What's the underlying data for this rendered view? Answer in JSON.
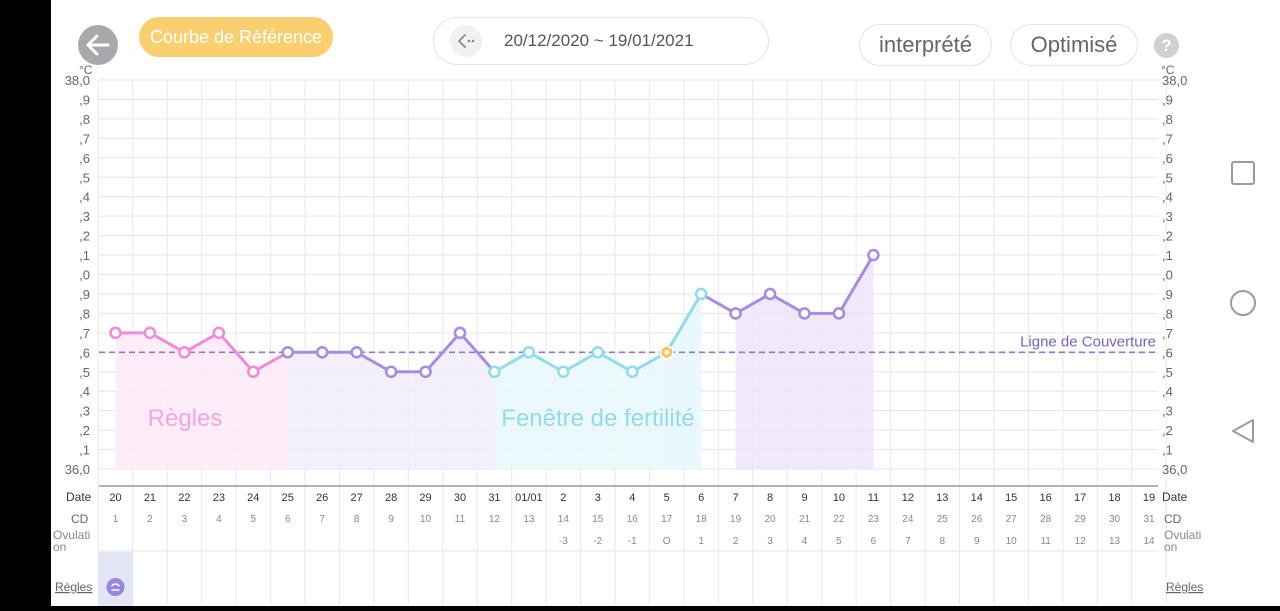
{
  "header": {
    "reference_curve_label": "Courbe de Référence",
    "date_range": "20/12/2020 ~ 19/01/2021",
    "interpret_label": "interprété",
    "optimize_label": "Optimisé",
    "help_label": "?"
  },
  "chart_data": {
    "type": "line",
    "unit": "°C",
    "ylim": [
      36.0,
      38.0
    ],
    "ytick_labels": [
      "38,0",
      ",9",
      ",8",
      ",7",
      ",6",
      ",5",
      ",4",
      ",3",
      ",2",
      ",1",
      ",0",
      ",9",
      ",8",
      ",7",
      ",6",
      ",5",
      ",4",
      ",3",
      ",2",
      ",1",
      "36,0"
    ],
    "row_labels": {
      "date": "Date",
      "cd": "CD",
      "ovulation": [
        "Ovulati",
        "on"
      ],
      "regles": "Règles"
    },
    "dates": [
      "20",
      "21",
      "22",
      "23",
      "24",
      "25",
      "26",
      "27",
      "28",
      "29",
      "30",
      "31",
      "01/01",
      "2",
      "3",
      "4",
      "5",
      "6",
      "7",
      "8",
      "9",
      "10",
      "11",
      "12",
      "13",
      "14",
      "15",
      "16",
      "17",
      "18",
      "19"
    ],
    "cd": [
      "1",
      "2",
      "3",
      "4",
      "5",
      "6",
      "7",
      "8",
      "9",
      "10",
      "11",
      "12",
      "13",
      "14",
      "15",
      "16",
      "17",
      "18",
      "19",
      "20",
      "21",
      "22",
      "23",
      "24",
      "25",
      "26",
      "27",
      "28",
      "29",
      "30",
      "31"
    ],
    "ovulation": [
      "",
      "",
      "",
      "",
      "",
      "",
      "",
      "",
      "",
      "",
      "",
      "",
      "",
      "-3",
      "-2",
      "-1",
      "O",
      "1",
      "2",
      "3",
      "4",
      "5",
      "6",
      "7",
      "8",
      "9",
      "10",
      "11",
      "12",
      "13",
      "14"
    ],
    "temperatures": [
      36.7,
      36.7,
      36.6,
      36.7,
      36.5,
      36.6,
      36.6,
      36.6,
      36.5,
      36.5,
      36.7,
      36.5,
      36.6,
      36.5,
      36.6,
      36.5,
      36.6,
      36.9,
      36.8,
      36.9,
      36.8,
      36.8,
      37.1
    ],
    "coverline": {
      "value": 36.6,
      "label": "Ligne de Couverture"
    },
    "phases": [
      {
        "name": "Règles",
        "start": 0,
        "end": 5,
        "color": "#f28ad8",
        "fill": "#fdeaf8"
      },
      {
        "name": "",
        "start": 5,
        "end": 11,
        "color": "#a98be3",
        "fill": "#f1ecfb"
      },
      {
        "name": "Fenêtre de fertilité",
        "start": 11,
        "end": 17,
        "color": "#8fdcea",
        "fill": "#e9f8fb"
      },
      {
        "name": "",
        "start": 18,
        "end": 22,
        "color": "#a98be3",
        "fill": "#ece5fa"
      }
    ],
    "ovulation_day_index": 16,
    "ovulation_marker_color": "#f9c56a",
    "period_marker_day_index": 0,
    "period_marker_color": "#9b85e0"
  }
}
